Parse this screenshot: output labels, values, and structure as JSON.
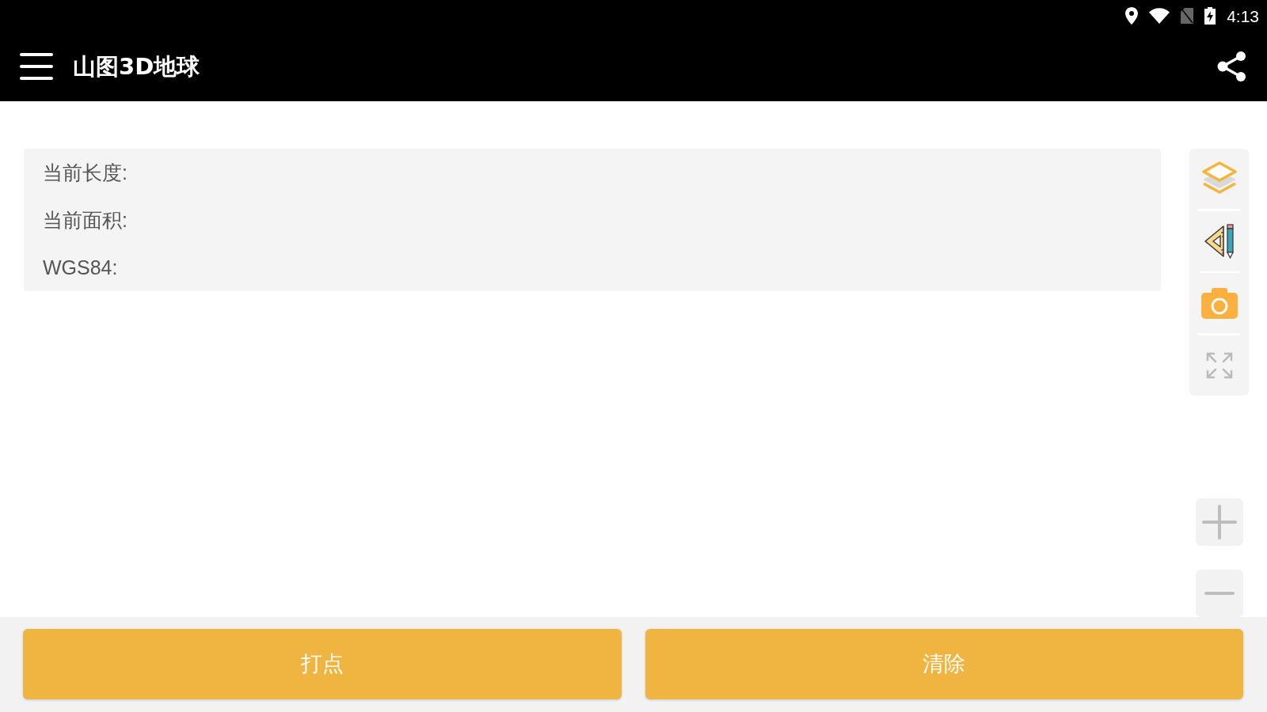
{
  "status_bar": {
    "time": "4:13"
  },
  "app_bar": {
    "title": "山图3D地球"
  },
  "info_panel": {
    "rows": [
      {
        "label": "当前长度:"
      },
      {
        "label": "当前面积:"
      },
      {
        "label": "WGS84:"
      }
    ]
  },
  "buttons": [
    {
      "label": "打点"
    },
    {
      "label": "清除"
    }
  ]
}
